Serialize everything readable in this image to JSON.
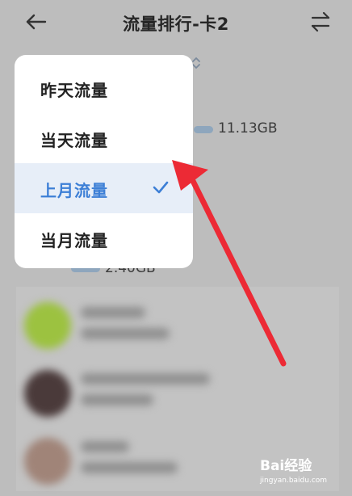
{
  "header": {
    "title": "流量排行-卡2",
    "back_icon": "back-arrow-icon",
    "switch_icon": "swap-icon"
  },
  "background_list": {
    "visible_amounts": [
      "11.13GB",
      "2.40GB"
    ]
  },
  "menu": {
    "items": [
      {
        "label": "昨天流量",
        "selected": false
      },
      {
        "label": "当天流量",
        "selected": false
      },
      {
        "label": "上月流量",
        "selected": true
      },
      {
        "label": "当月流量",
        "selected": false
      }
    ],
    "check_icon": "check-icon"
  },
  "annotation": {
    "arrow_color": "#ec2a35"
  },
  "watermark": {
    "brand": "Bai经验",
    "url": "jingyan.baidu.com"
  },
  "colors": {
    "accent": "#3d7fd6",
    "selected_bg": "#e7eef8",
    "overlay_bg": "#bdbdbd"
  }
}
